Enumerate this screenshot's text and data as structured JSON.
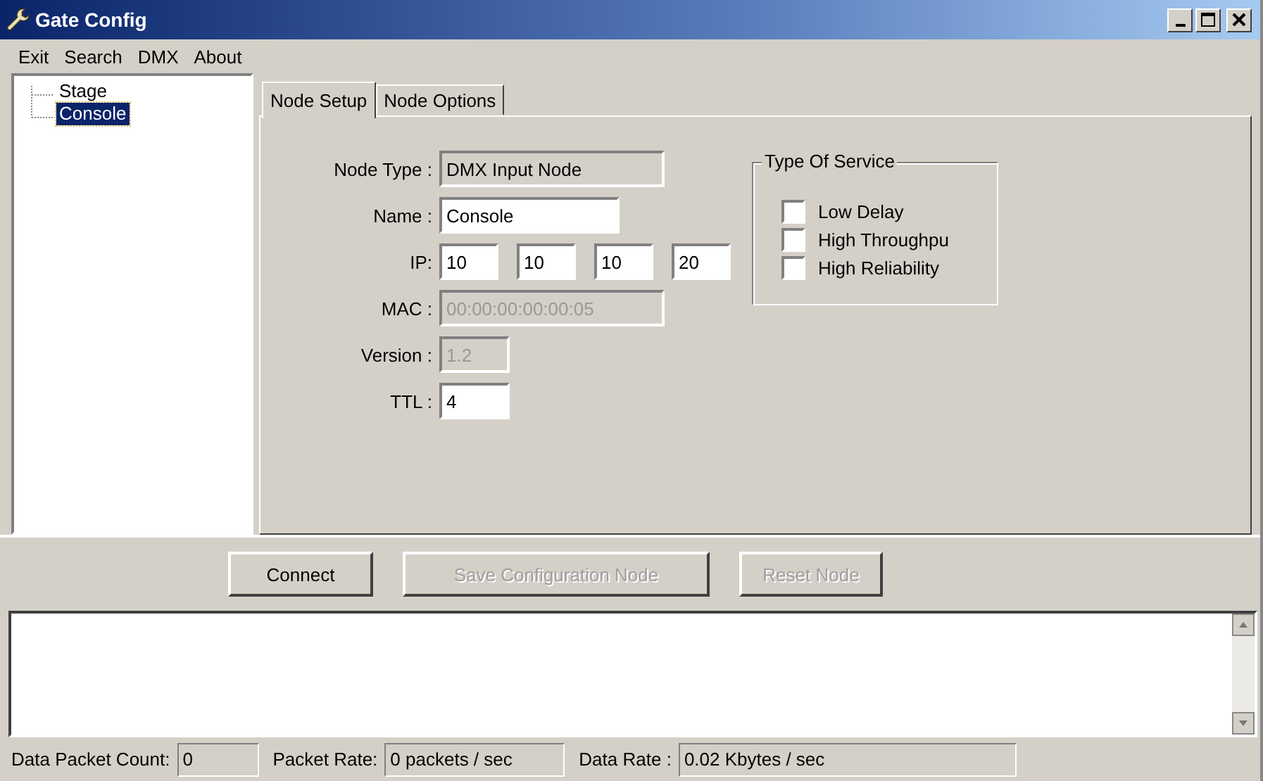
{
  "window": {
    "title": "Gate Config"
  },
  "menu": [
    "Exit",
    "Search",
    "DMX",
    "About"
  ],
  "tree": [
    {
      "label": "Stage",
      "selected": false
    },
    {
      "label": "Console",
      "selected": true
    }
  ],
  "tabs": [
    {
      "label": "Node Setup",
      "selected": true
    },
    {
      "label": "Node Options",
      "selected": false
    }
  ],
  "fields": [
    {
      "label": "Node Type :",
      "kind": "readonly",
      "values": [
        "DMX Input Node"
      ]
    },
    {
      "label": "Name :",
      "kind": "edit",
      "values": [
        "Console"
      ]
    },
    {
      "label": "IP:",
      "kind": "ip",
      "values": [
        "10",
        "10",
        "10",
        "20"
      ]
    },
    {
      "label": "MAC :",
      "kind": "disabled",
      "values": [
        "00:00:00:00:00:05"
      ]
    },
    {
      "label": "Version :",
      "kind": "disabled",
      "values": [
        "1.2"
      ]
    },
    {
      "label": "TTL :",
      "kind": "edit",
      "values": [
        "4"
      ]
    }
  ],
  "type_of_service": {
    "title": "Type Of Service",
    "options": [
      {
        "label": "Low Delay",
        "checked": false
      },
      {
        "label": "High Throughpu",
        "checked": false
      },
      {
        "label": "High Reliability",
        "checked": false
      }
    ]
  },
  "buttons": [
    {
      "label": "Connect",
      "disabled": false
    },
    {
      "label": "Save Configuration Node",
      "disabled": true
    },
    {
      "label": "Reset Node",
      "disabled": true
    }
  ],
  "status_bar": [
    {
      "label": "Data Packet Count:",
      "value": "0"
    },
    {
      "label": "Packet Rate:",
      "value": "0 packets / sec"
    },
    {
      "label": "Data Rate :",
      "value": "0.02 Kbytes / sec"
    }
  ]
}
